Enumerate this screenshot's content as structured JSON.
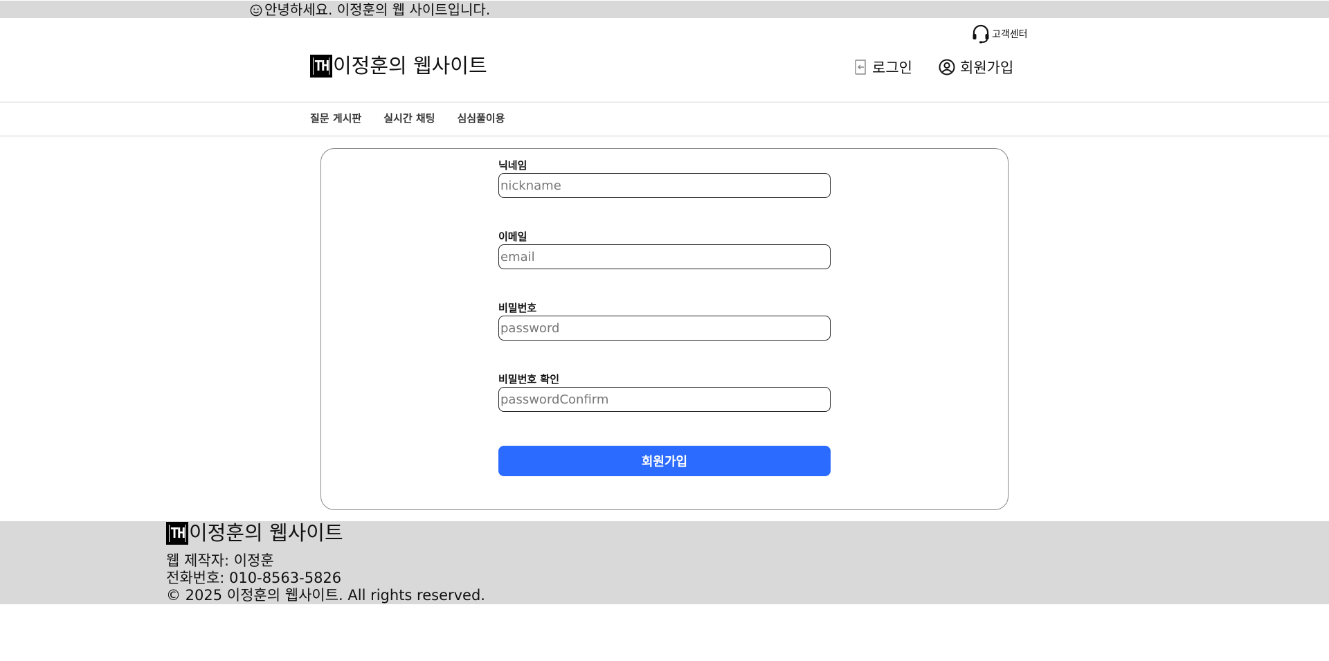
{
  "announcement": {
    "text": "안녕하세요. 이정훈의 웹 사이트입니다."
  },
  "header": {
    "support_label": "고객센터",
    "logo_text": "TH",
    "site_title": "이정훈의 웹사이트",
    "login_label": "로그인",
    "signup_label": "회원가입"
  },
  "nav": {
    "items": [
      {
        "label": "질문 게시판"
      },
      {
        "label": "실시간 채팅"
      },
      {
        "label": "심심풀이용"
      }
    ]
  },
  "form": {
    "fields": [
      {
        "label": "닉네임",
        "placeholder": "nickname",
        "value": ""
      },
      {
        "label": "이메일",
        "placeholder": "email",
        "value": ""
      },
      {
        "label": "비밀번호",
        "placeholder": "password",
        "value": ""
      },
      {
        "label": "비밀번호 확인",
        "placeholder": "passwordConfirm",
        "value": ""
      }
    ],
    "submit_label": "회원가입"
  },
  "footer": {
    "logo_text": "TH",
    "site_title": "이정훈의 웹사이트",
    "maker": "웹 제작자: 이정훈",
    "phone": "전화번호: 010-8563-5826",
    "copyright": "© 2025 이정훈의 웹사이트. All rights reserved."
  },
  "colors": {
    "accent": "#2b6bff",
    "bar_background": "#d9d9d9"
  },
  "icons": [
    "smile-icon",
    "headset-icon",
    "login-icon",
    "user-circle-icon"
  ]
}
